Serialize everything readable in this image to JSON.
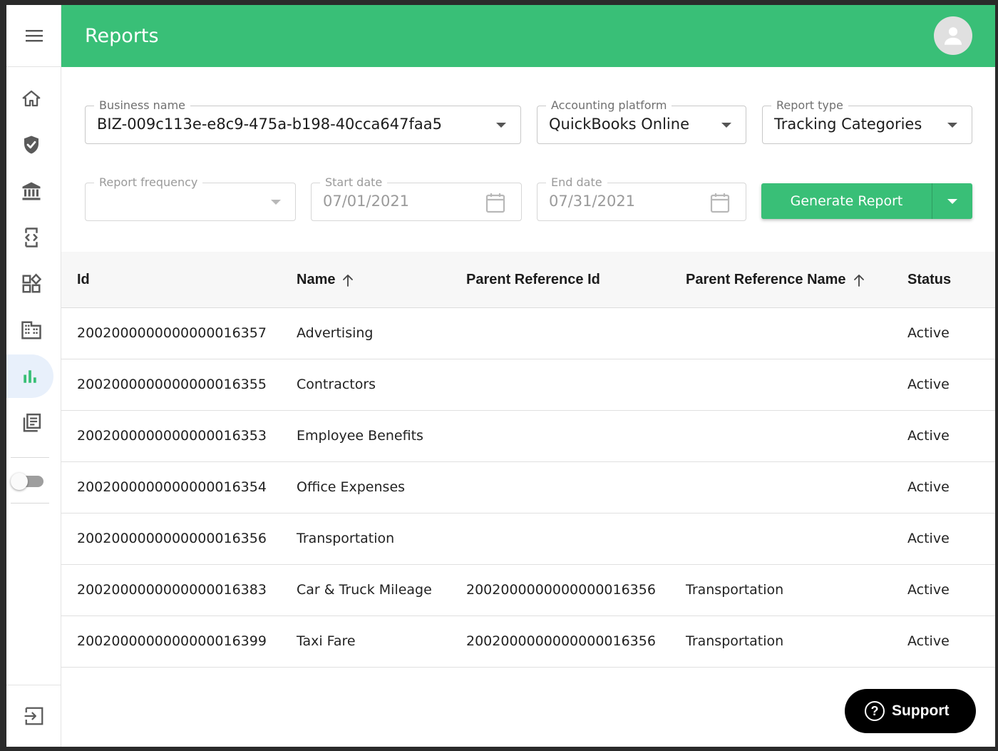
{
  "header": {
    "title": "Reports"
  },
  "filters": {
    "business_name": {
      "label": "Business name",
      "value": "BIZ-009c113e-e8c9-475a-b198-40cca647faa5"
    },
    "accounting_platform": {
      "label": "Accounting platform",
      "value": "QuickBooks Online"
    },
    "report_type": {
      "label": "Report type",
      "value": "Tracking Categories"
    },
    "report_frequency": {
      "label": "Report frequency",
      "value": ""
    },
    "start_date": {
      "label": "Start date",
      "value": "07/01/2021"
    },
    "end_date": {
      "label": "End date",
      "value": "07/31/2021"
    }
  },
  "generate_button": {
    "label": "Generate Report"
  },
  "sidebar": {
    "items": [
      {
        "name": "home",
        "icon": "home-icon"
      },
      {
        "name": "security",
        "icon": "shield-check-icon"
      },
      {
        "name": "bank",
        "icon": "bank-icon"
      },
      {
        "name": "developer",
        "icon": "code-device-icon"
      },
      {
        "name": "widgets",
        "icon": "widgets-icon"
      },
      {
        "name": "business",
        "icon": "building-icon"
      },
      {
        "name": "reports",
        "icon": "bar-chart-icon",
        "active": true
      },
      {
        "name": "library",
        "icon": "library-books-icon"
      }
    ],
    "toggle_on": false
  },
  "table": {
    "columns": [
      "Id",
      "Name",
      "Parent Reference Id",
      "Parent Reference Name",
      "Status"
    ],
    "rows": [
      {
        "id": "2002000000000000016357",
        "name": "Advertising",
        "parent_id": "",
        "parent_name": "",
        "status": "Active"
      },
      {
        "id": "2002000000000000016355",
        "name": "Contractors",
        "parent_id": "",
        "parent_name": "",
        "status": "Active"
      },
      {
        "id": "2002000000000000016353",
        "name": "Employee Benefits",
        "parent_id": "",
        "parent_name": "",
        "status": "Active"
      },
      {
        "id": "2002000000000000016354",
        "name": "Office Expenses",
        "parent_id": "",
        "parent_name": "",
        "status": "Active"
      },
      {
        "id": "2002000000000000016356",
        "name": "Transportation",
        "parent_id": "",
        "parent_name": "",
        "status": "Active"
      },
      {
        "id": "2002000000000000016383",
        "name": "Car & Truck Mileage",
        "parent_id": "2002000000000000016356",
        "parent_name": "Transportation",
        "status": "Active"
      },
      {
        "id": "2002000000000000016399",
        "name": "Taxi Fare",
        "parent_id": "2002000000000000016356",
        "parent_name": "Transportation",
        "status": "Active"
      }
    ]
  },
  "support": {
    "label": "Support"
  },
  "colors": {
    "brand": "#39bf77",
    "active_nav_bg": "#e8f0fb",
    "support_bg": "#000000"
  }
}
